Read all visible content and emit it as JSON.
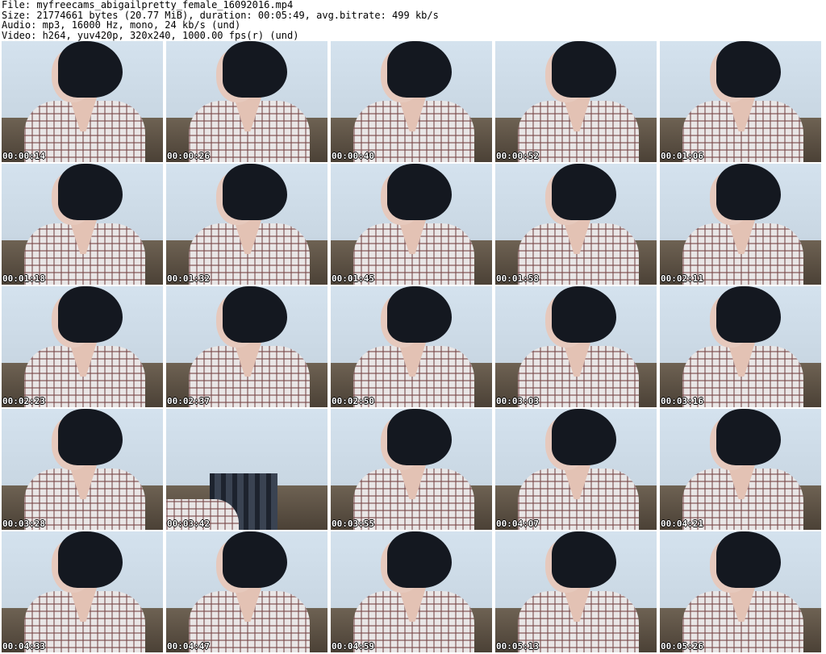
{
  "header": {
    "file_line": "File: myfreecams_abigailpretty_female_16092016.mp4",
    "size_line": "Size: 21774661 bytes (20.77 MiB), duration: 00:05:49, avg.bitrate: 499 kb/s",
    "audio_line": "Audio: mp3, 16000 Hz, mono, 24 kb/s (und)",
    "video_line": "Video: h264, yuv420p, 320x240, 1000.00 fps(r) (und)"
  },
  "thumbnails": [
    "00:00:14",
    "00:00:26",
    "00:00:40",
    "00:00:52",
    "00:01:06",
    "00:01:18",
    "00:01:32",
    "00:01:45",
    "00:01:58",
    "00:02:11",
    "00:02:23",
    "00:02:37",
    "00:02:50",
    "00:03:03",
    "00:03:16",
    "00:03:28",
    "00:03:42",
    "00:03:55",
    "00:04:07",
    "00:04:21",
    "00:04:33",
    "00:04:47",
    "00:04:59",
    "00:05:13",
    "00:05:26"
  ]
}
